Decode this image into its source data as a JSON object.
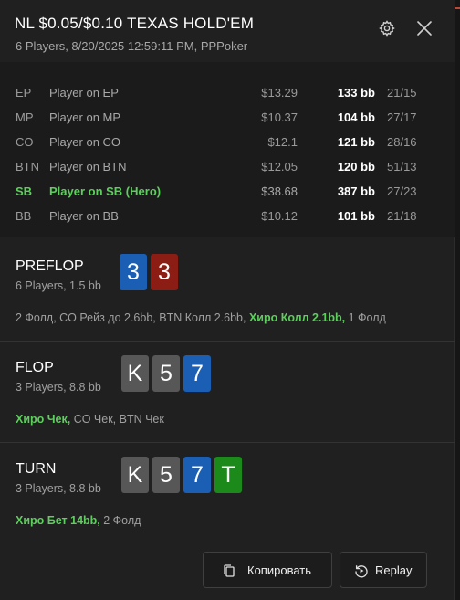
{
  "header": {
    "title": "NL $0.05/$0.10 TEXAS HOLD'EM",
    "subtitle": "6 Players, 8/20/2025 12:59:11 PM, PPPoker"
  },
  "players": [
    {
      "pos": "EP",
      "name": "Player on EP",
      "money": "$13.29",
      "bb": "133 bb",
      "stat": "21/15",
      "hero": false
    },
    {
      "pos": "MP",
      "name": "Player on MP",
      "money": "$10.37",
      "bb": "104 bb",
      "stat": "27/17",
      "hero": false
    },
    {
      "pos": "CO",
      "name": "Player on CO",
      "money": "$12.1",
      "bb": "121 bb",
      "stat": "28/16",
      "hero": false
    },
    {
      "pos": "BTN",
      "name": "Player on BTN",
      "money": "$12.05",
      "bb": "120 bb",
      "stat": "51/13",
      "hero": false
    },
    {
      "pos": "SB",
      "name": "Player on SB (Hero)",
      "money": "$38.68",
      "bb": "387 bb",
      "stat": "27/23",
      "hero": true
    },
    {
      "pos": "BB",
      "name": "Player on BB",
      "money": "$10.12",
      "bb": "101 bb",
      "stat": "21/18",
      "hero": false
    }
  ],
  "streets": [
    {
      "name": "PREFLOP",
      "info": "6 Players, 1.5 bb",
      "cards": [
        {
          "rank": "3",
          "suit_color": "blue"
        },
        {
          "rank": "3",
          "suit_color": "red"
        }
      ],
      "actions": [
        {
          "text": "2 Фолд, CO Рейз до 2.6bb, BTN Колл 2.6bb, ",
          "hero": false
        },
        {
          "text": "Хиро Колл 2.1bb,",
          "hero": true
        },
        {
          "text": " 1 Фолд",
          "hero": false
        }
      ]
    },
    {
      "name": "FLOP",
      "info": "3 Players, 8.8 bb",
      "cards": [
        {
          "rank": "K",
          "suit_color": "gray"
        },
        {
          "rank": "5",
          "suit_color": "gray"
        },
        {
          "rank": "7",
          "suit_color": "blue"
        }
      ],
      "actions": [
        {
          "text": "Хиро Чек,",
          "hero": true
        },
        {
          "text": " CO Чек, BTN Чек",
          "hero": false
        }
      ]
    },
    {
      "name": "TURN",
      "info": "3 Players, 8.8 bb",
      "cards": [
        {
          "rank": "K",
          "suit_color": "gray"
        },
        {
          "rank": "5",
          "suit_color": "gray"
        },
        {
          "rank": "7",
          "suit_color": "blue"
        },
        {
          "rank": "T",
          "suit_color": "green"
        }
      ],
      "actions": [
        {
          "text": "Хиро Бет 14bb,",
          "hero": true
        },
        {
          "text": " 2 Фолд",
          "hero": false
        }
      ]
    }
  ],
  "footer": {
    "copy_label": "Копировать",
    "replay_label": "Replay"
  },
  "icons": {
    "settings": "gear-icon",
    "close": "close-icon",
    "copy": "copy-icon",
    "replay": "replay-icon"
  },
  "colors": {
    "hero": "#5dcf5d",
    "card_blue": "#1a5fb4",
    "card_red": "#8c1d14",
    "card_gray": "#575757",
    "card_green": "#1b8a1b"
  }
}
